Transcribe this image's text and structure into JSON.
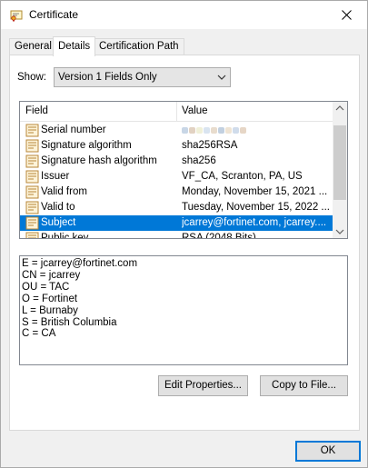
{
  "window": {
    "title": "Certificate",
    "icon": "certificate-icon"
  },
  "tabs": [
    {
      "label": "General"
    },
    {
      "label": "Details"
    },
    {
      "label": "Certification Path"
    }
  ],
  "active_tab": "Details",
  "show": {
    "label": "Show:",
    "selected": "Version 1 Fields Only"
  },
  "list": {
    "columns": {
      "field": "Field",
      "value": "Value"
    },
    "rows": [
      {
        "field": "Serial number",
        "value": "",
        "value_obscured": true
      },
      {
        "field": "Signature algorithm",
        "value": "sha256RSA"
      },
      {
        "field": "Signature hash algorithm",
        "value": "sha256"
      },
      {
        "field": "Issuer",
        "value": "VF_CA, Scranton, PA, US"
      },
      {
        "field": "Valid from",
        "value": "Monday, November 15, 2021 ..."
      },
      {
        "field": "Valid to",
        "value": "Tuesday, November 15, 2022 ..."
      },
      {
        "field": "Subject",
        "value": "jcarrey@fortinet.com, jcarrey....",
        "selected": true
      },
      {
        "field": "Public key",
        "value": "RSA (2048 Bits)"
      }
    ]
  },
  "detail_lines": [
    "E = jcarrey@fortinet.com",
    "CN = jcarrey",
    "OU = TAC",
    "O = Fortinet",
    "L = Burnaby",
    "S = British Columbia",
    "C = CA"
  ],
  "buttons": {
    "edit_properties": "Edit Properties...",
    "copy_to_file": "Copy to File...",
    "ok": "OK"
  },
  "colors": {
    "selection": "#0078d7",
    "dialog_bg": "#f0f0f0",
    "default_button_border": "#0078d7"
  }
}
